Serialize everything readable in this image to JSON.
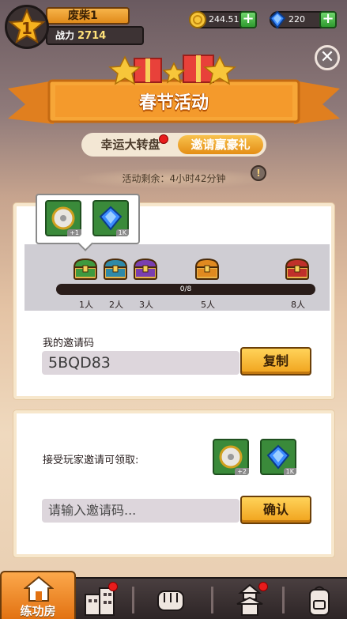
{
  "player": {
    "level": "1",
    "name": "废柴1",
    "power_label": "战力",
    "power_value": "2714"
  },
  "resources": {
    "gold": "244.51K",
    "gems": "220"
  },
  "event": {
    "title": "春节活动",
    "tabs": [
      {
        "label": "幸运大转盘"
      },
      {
        "label": "邀请赢豪礼"
      }
    ],
    "timer": "活动剩余：4小时42分钟"
  },
  "milestones": {
    "progress_text": "0/8",
    "progress": 0,
    "popup_items": [
      {
        "icon": "disc-icon",
        "count": "+1"
      },
      {
        "icon": "gem-icon",
        "count": "1K"
      }
    ],
    "nodes": [
      {
        "label": "1人",
        "color": "#3f9a3f"
      },
      {
        "label": "2人",
        "color": "#2f8aa8"
      },
      {
        "label": "3人",
        "color": "#7a3fb0"
      },
      {
        "label": "5人",
        "color": "#e08a20"
      },
      {
        "label": "8人",
        "color": "#c0302a"
      }
    ]
  },
  "my_code": {
    "label": "我的邀请码",
    "value": "5BQD83",
    "copy_label": "复制"
  },
  "accept": {
    "label": "接受玩家邀请可领取:",
    "rewards": [
      {
        "icon": "disc-icon",
        "count": "+2"
      },
      {
        "icon": "gem-icon",
        "count": "1K"
      }
    ],
    "placeholder": "请输入邀请码...",
    "confirm_label": "确认"
  },
  "nav": {
    "home_label": "练功房"
  },
  "colors": {
    "accent": "#f0a21b",
    "banner": "#f39a2e",
    "reddot": "#e81c1c"
  }
}
